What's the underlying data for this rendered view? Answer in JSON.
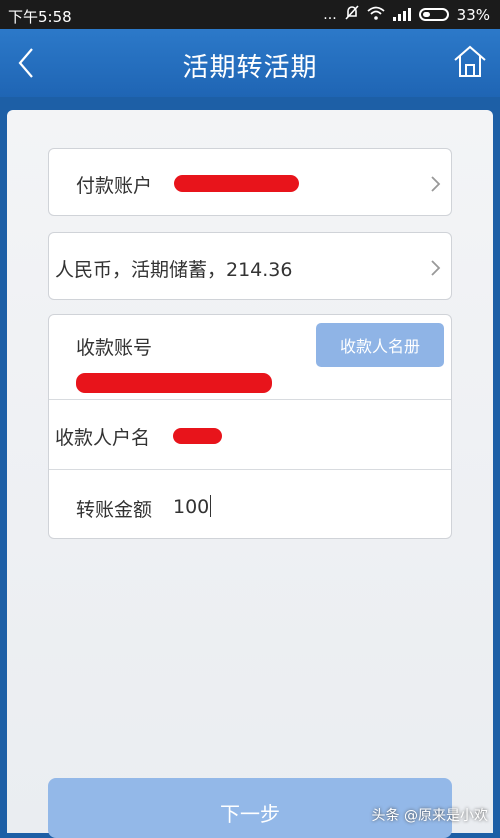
{
  "status_bar": {
    "time": "下午5:58",
    "dots": "...",
    "battery": "33%",
    "battery_level": 0.33
  },
  "header": {
    "title": "活期转活期",
    "back_icon": "chevron-left-icon",
    "home_icon": "home-icon"
  },
  "form": {
    "payer_account_label": "付款账户",
    "account_summary": "人民币，活期储蓄，214.36",
    "payee_account_label": "收款账号",
    "payee_book_label": "收款人名册",
    "payee_name_label": "收款人户名",
    "amount_label": "转账金额",
    "amount_value": "100"
  },
  "footer": {
    "next_label": "下一步",
    "watermark": "头条 @原来是小欢"
  },
  "colors": {
    "primary_blue": "#1f65b4",
    "redaction_red": "#e8141b",
    "button_blue": "#93b8e8"
  }
}
